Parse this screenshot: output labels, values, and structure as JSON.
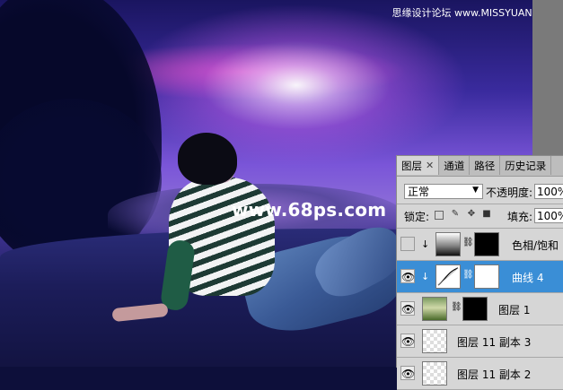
{
  "watermark": {
    "url_text": "www.68ps.com",
    "site_text": "思缘设计论坛 www.MISSYUAN.COM"
  },
  "panel": {
    "tabs": [
      {
        "label": "图层",
        "active": true,
        "closable": true
      },
      {
        "label": "通道",
        "active": false
      },
      {
        "label": "路径",
        "active": false
      },
      {
        "label": "历史记录",
        "active": false
      }
    ],
    "blend_mode": "正常",
    "opacity_label": "不透明度:",
    "opacity_value": "100%",
    "lock_label": "锁定:",
    "fill_label": "填充:",
    "fill_value": "100%",
    "layers": [
      {
        "name": "色相/饱和",
        "visible": false,
        "selected": false
      },
      {
        "name": "曲线 4",
        "visible": true,
        "selected": true
      },
      {
        "name": "图层 1",
        "visible": true,
        "selected": false
      },
      {
        "name": "图层 11 副本 3",
        "visible": true,
        "selected": false
      },
      {
        "name": "图层 11 副本 2",
        "visible": true,
        "selected": false
      }
    ]
  },
  "colors": {
    "selected_layer": "#3a8ed6",
    "panel_bg": "#d6d6d6"
  }
}
